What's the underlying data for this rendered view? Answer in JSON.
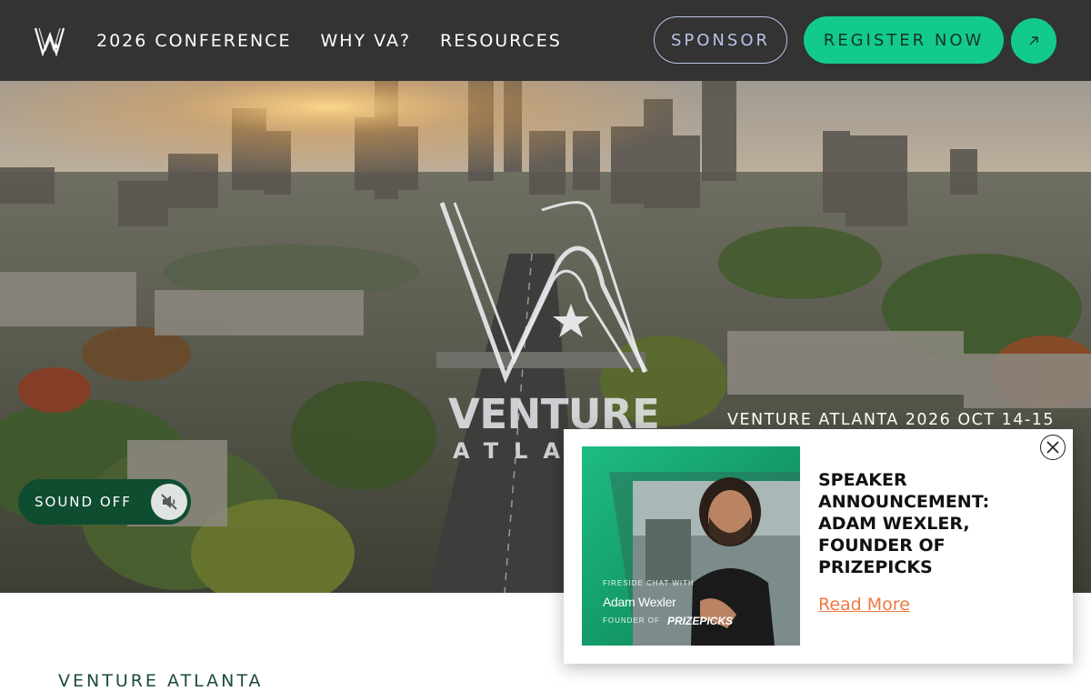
{
  "nav": {
    "links": [
      "2026 CONFERENCE",
      "WHY VA?",
      "RESOURCES"
    ],
    "sponsor_label": "SPONSOR",
    "register_label": "REGISTER NOW",
    "arrow_icon": "arrow-up-right-icon"
  },
  "hero": {
    "logo_text_1": "VENTURE",
    "logo_text_2": "ATLANTA",
    "event_date": "VENTURE ATLANTA 2026 OCT 14-15",
    "sound_label": "SOUND OFF",
    "sound_icon": "speaker-muted-icon"
  },
  "popup": {
    "title": "SPEAKER ANNOUNCEMENT: ADAM WEXLER, FOUNDER OF PRIZEPICKS",
    "link_label": "Read More",
    "close_icon": "close-icon",
    "promo": {
      "caption_top": "FIRESIDE CHAT WITH",
      "speaker": "Adam Wexler",
      "caption_bottom": "FOUNDER OF",
      "brand": "PRIZEPICKS"
    }
  },
  "page": {
    "section_heading": "VENTURE ATLANTA"
  },
  "colors": {
    "nav_bg": "#333333",
    "accent_green": "#12cb8b",
    "dark_green": "#0f4d31",
    "link_orange": "#ee7a43"
  }
}
